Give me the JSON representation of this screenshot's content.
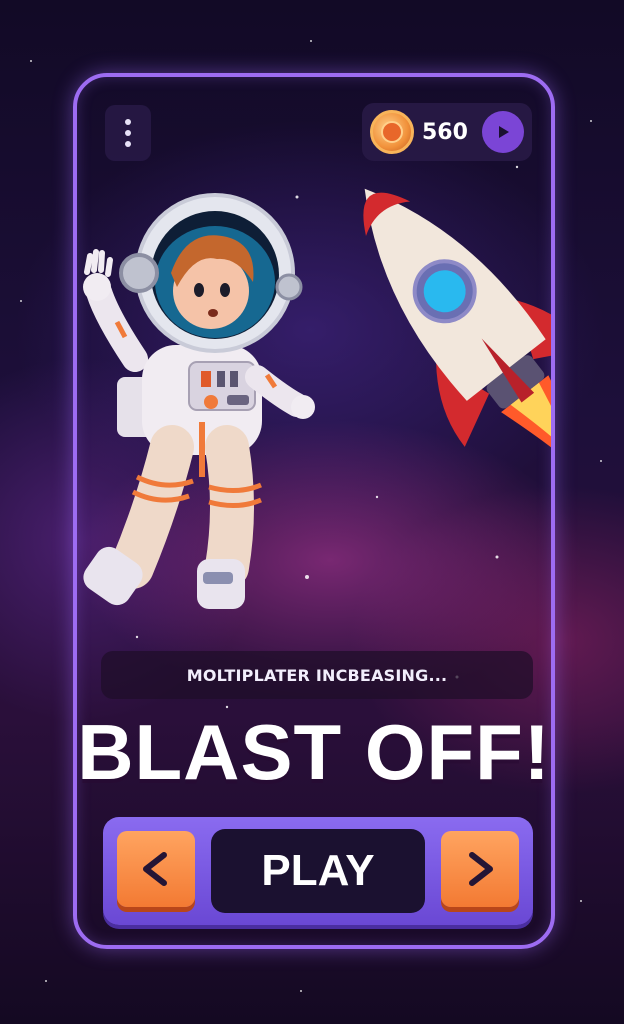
{
  "hud": {
    "coin_count": "560",
    "icons": {
      "menu": "vertical-dots-icon",
      "coin": "coin-icon",
      "add": "play-triangle-icon"
    }
  },
  "status": {
    "text": "MOLTIPLATER INCBEASING..."
  },
  "headline": "BLAST OFF!",
  "controls": {
    "play_label": "PLAY",
    "left_icon": "chevron-left-icon",
    "right_icon": "chevron-right-icon"
  },
  "colors": {
    "frame": "#9d6cf2",
    "accent_purple": "#7b45d6",
    "button_orange": "#f37a33",
    "panel_dark": "#1b1130"
  }
}
